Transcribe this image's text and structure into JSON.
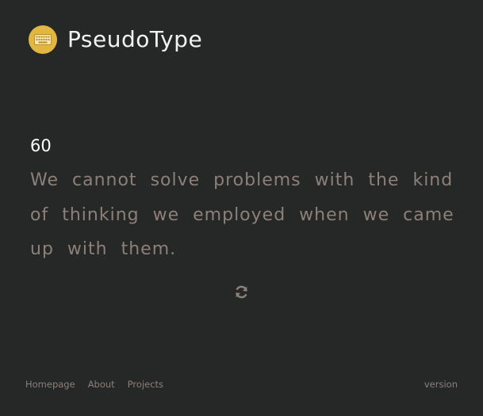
{
  "header": {
    "logo_icon": "keyboard-icon",
    "title": "PseudoType"
  },
  "typing": {
    "timer": "60",
    "quote_words": [
      "We",
      "cannot",
      "solve",
      "problems",
      "with",
      "the",
      "kind",
      "of",
      "thinking",
      "we",
      "employed",
      "when",
      "we",
      "came",
      "up",
      "with",
      "them."
    ],
    "refresh_icon": "refresh-icon"
  },
  "footer": {
    "links": [
      "Homepage",
      "About",
      "Projects"
    ],
    "version": "version"
  },
  "colors": {
    "background": "#262828",
    "accent": "#e2b741",
    "quote_text": "#8d7f79",
    "title_text": "#f2f2f2"
  }
}
